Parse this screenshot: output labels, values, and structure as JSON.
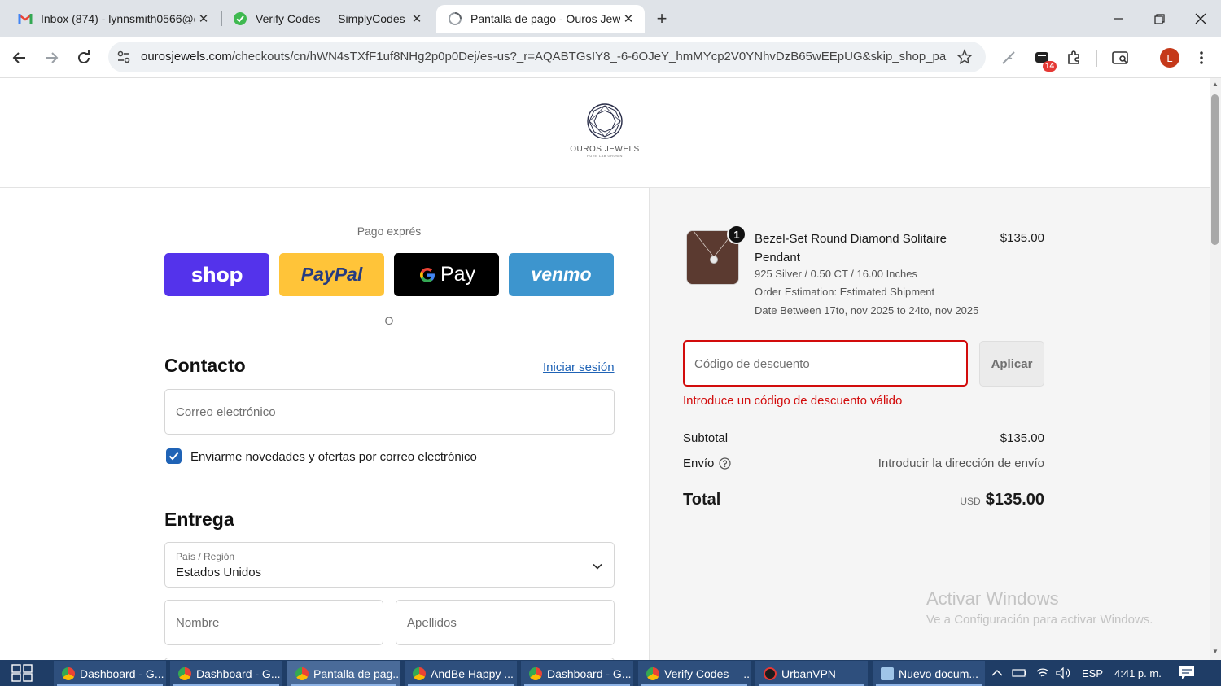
{
  "browser": {
    "tabs": [
      {
        "title": "Inbox (874) - lynnsmith0566@g",
        "favicon": "gmail-icon"
      },
      {
        "title": "Verify Codes — SimplyCodes",
        "favicon": "simplycodes-icon"
      },
      {
        "title": "Pantalla de pago - Ouros Jewel",
        "favicon": "loading-icon",
        "active": true
      }
    ],
    "url_host": "ourosjewels.com",
    "url_rest": "/checkouts/cn/hWN4sTXfF1uf8NHg2p0p0Dej/es-us?_r=AQABTGsIY8_-6-6OJeY_hmMYcp2V0YNhvDzB65wEEpUG&skip_shop_pa...",
    "extension_badge": "14",
    "profile_initial": "L"
  },
  "store": {
    "logo_name": "OUROS JEWELS",
    "logo_tagline": "PURE LAB GROWN"
  },
  "checkout": {
    "express_title": "Pago exprés",
    "express_buttons": {
      "shop": "shop",
      "paypal": "PayPal",
      "gpay": "Pay",
      "venmo": "venmo"
    },
    "or_label": "O",
    "contact_title": "Contacto",
    "login_link": "Iniciar sesión",
    "email_placeholder": "Correo electrónico",
    "newsletter_label": "Enviarme novedades y ofertas por correo electrónico",
    "delivery_title": "Entrega",
    "country_label": "País / Región",
    "country_value": "Estados Unidos",
    "first_name_placeholder": "Nombre",
    "last_name_placeholder": "Apellidos"
  },
  "summary": {
    "quantity": "1",
    "product_name": "Bezel-Set Round Diamond Solitaire Pendant",
    "product_price": "$135.00",
    "product_variant": "925 Silver / 0.50 CT / 16.00 Inches",
    "order_estimation": "Order Estimation:  Estimated Shipment",
    "date_range": "Date Between 17to, nov 2025 to 24to, nov 2025",
    "discount_placeholder": "Código de descuento",
    "apply_label": "Aplicar",
    "discount_error": "Introduce un código de descuento válido",
    "subtotal_label": "Subtotal",
    "subtotal_value": "$135.00",
    "shipping_label": "Envío",
    "shipping_value": "Introducir la dirección de envío",
    "total_label": "Total",
    "currency": "USD",
    "total_value": "$135.00"
  },
  "watermark": {
    "line1": "Activar Windows",
    "line2": "Ve a Configuración para activar Windows."
  },
  "taskbar": {
    "items": [
      {
        "label": "Dashboard - G..."
      },
      {
        "label": "Dashboard - G..."
      },
      {
        "label": "Pantalla de pag..."
      },
      {
        "label": "AndBe Happy ..."
      },
      {
        "label": "Dashboard - G..."
      },
      {
        "label": "Verify Codes —..."
      },
      {
        "label": "UrbanVPN"
      },
      {
        "label": "Nuevo docum..."
      }
    ],
    "language": "ESP",
    "time": "4:41 p. m."
  },
  "colors": {
    "shop": "#5433eb",
    "paypal": "#ffc439",
    "gpay": "#000000",
    "venmo": "#3d95ce",
    "error": "#d20c0c",
    "link": "#1f63b6"
  }
}
